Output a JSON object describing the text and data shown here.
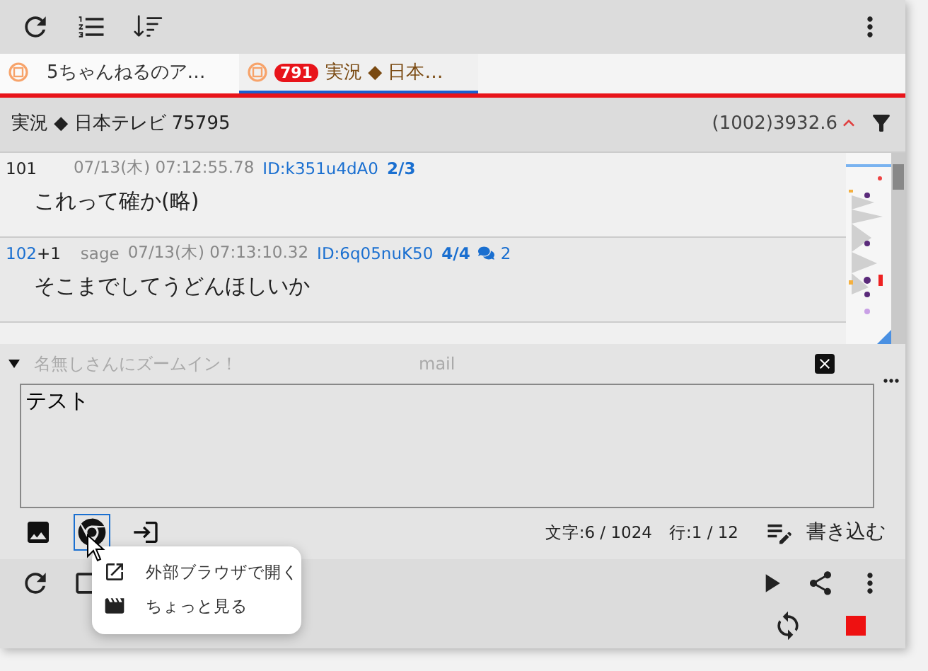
{
  "tabs": [
    {
      "label": "5ちゃんねるのア…",
      "selected": false
    },
    {
      "badge": "791",
      "label": "実況 ◆ 日本…",
      "selected": true
    }
  ],
  "thread": {
    "title": "実況 ◆ 日本テレビ 75795",
    "speed": "(1002)3932.6"
  },
  "posts": [
    {
      "number": "101",
      "date": "07/13(木) 07:12:55.78",
      "id": "ID:k351u4dA0",
      "id_count": "2/3",
      "text": "これって確か(略)"
    },
    {
      "number": "102",
      "plus": "+1",
      "mail": "sage",
      "date": "07/13(木) 07:13:10.32",
      "id": "ID:6q05nuK50",
      "id_count": "4/4",
      "replies": "2",
      "text": "そこまでしてうどんほしいか"
    }
  ],
  "compose": {
    "name_placeholder": "名無しさんにズームイン！",
    "mail_placeholder": "mail",
    "body": "テスト",
    "char_count": "文字:6 / 1024",
    "line_count": "行:1 / 12",
    "submit": "書き込む"
  },
  "popup_menu": [
    {
      "kind": "external",
      "label": "外部ブラウザで開く"
    },
    {
      "kind": "preview",
      "label": "ちょっと見る"
    }
  ]
}
